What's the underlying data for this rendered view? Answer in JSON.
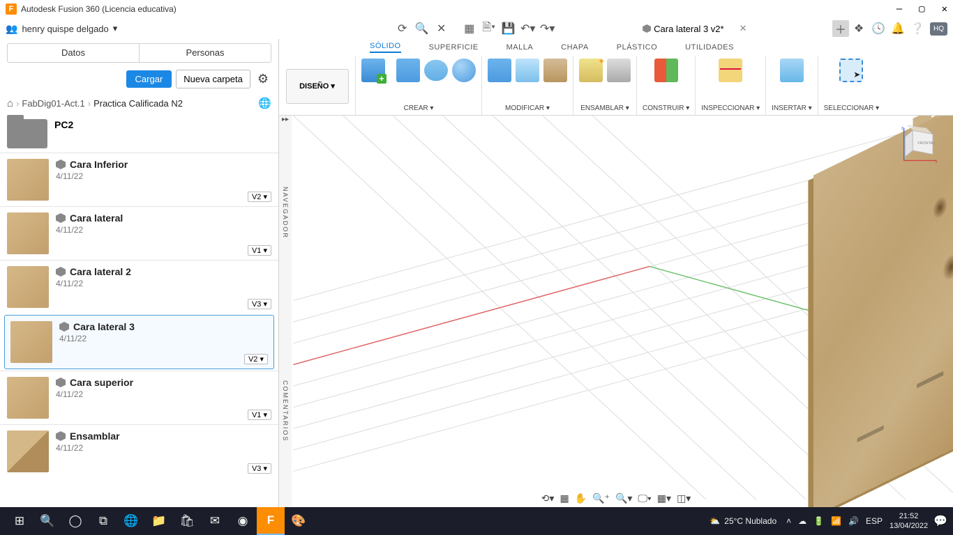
{
  "app": {
    "title": "Autodesk Fusion 360 (Licencia educativa)",
    "icon_letter": "F"
  },
  "user": {
    "name": "henry quispe delgado"
  },
  "left": {
    "tabs": [
      "Datos",
      "Personas"
    ],
    "btn_upload": "Cargar",
    "btn_newfolder": "Nueva carpeta",
    "breadcrumb": [
      "FabDig01-Act.1",
      "Practica Calificada N2"
    ],
    "folder": "PC2",
    "items": [
      {
        "name": "Cara Inferior",
        "date": "4/11/22",
        "version": "V2 ▾"
      },
      {
        "name": "Cara lateral",
        "date": "4/11/22",
        "version": "V1 ▾"
      },
      {
        "name": "Cara lateral 2",
        "date": "4/11/22",
        "version": "V3 ▾"
      },
      {
        "name": "Cara lateral 3",
        "date": "4/11/22",
        "version": "V2 ▾"
      },
      {
        "name": "Cara superior",
        "date": "4/11/22",
        "version": "V1 ▾"
      },
      {
        "name": "Ensamblar",
        "date": "4/11/22",
        "version": "V3 ▾"
      }
    ],
    "selected_index": 3
  },
  "doc_tab": {
    "title": "Cara lateral 3 v2*"
  },
  "hq_badge": "HQ",
  "ribbon": {
    "workspace_btn": "DISEÑO ▾",
    "tabs": [
      "SÓLIDO",
      "SUPERFICIE",
      "MALLA",
      "CHAPA",
      "PLÁSTICO",
      "UTILIDADES"
    ],
    "active_tab": 0,
    "groups": {
      "crear": "CREAR ▾",
      "modificar": "MODIFICAR ▾",
      "ensamblar": "ENSAMBLAR ▾",
      "construir": "CONSTRUIR ▾",
      "inspeccionar": "INSPECCIONAR ▾",
      "insertar": "INSERTAR ▾",
      "seleccionar": "SELECCIONAR ▾"
    }
  },
  "nav_rail": {
    "top": "NAVEGADOR",
    "bottom": "COMENTARIOS"
  },
  "taskbar": {
    "weather": "25°C  Nublado",
    "lang": "ESP",
    "time": "21:52",
    "date": "13/04/2022"
  }
}
